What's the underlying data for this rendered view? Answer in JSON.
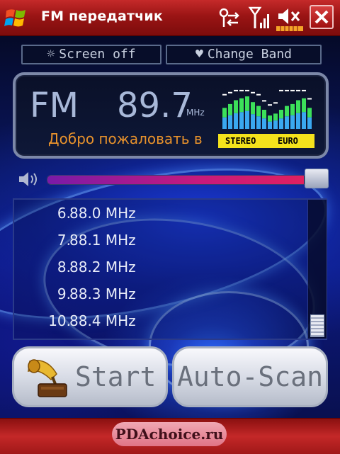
{
  "titlebar": {
    "title": "FM передатчик"
  },
  "toolbar": {
    "screen_off_label": "Screen off",
    "change_band_label": "Change Band"
  },
  "display": {
    "band": "FM",
    "frequency": "89.7",
    "frequency_unit": "MHz",
    "rds_text": "Добро пожаловать в",
    "stereo_label": "STEREO",
    "region_label": "EURO",
    "equalizer_levels": [
      0.55,
      0.65,
      0.75,
      0.8,
      0.85,
      0.7,
      0.6,
      0.5,
      0.35,
      0.4,
      0.5,
      0.6,
      0.65,
      0.75,
      0.8,
      0.55
    ],
    "equalizer_peaks": [
      0.85,
      0.9,
      0.95,
      0.95,
      0.95,
      0.9,
      0.85,
      0.7,
      0.6,
      0.65,
      0.95,
      0.95,
      0.95,
      0.95,
      0.95,
      0.75
    ]
  },
  "volume": {
    "level": 0.99
  },
  "presets": {
    "items": [
      {
        "number": "6.",
        "frequency": "88.0 MHz"
      },
      {
        "number": "7.",
        "frequency": "88.1 MHz"
      },
      {
        "number": "8.",
        "frequency": "88.2 MHz"
      },
      {
        "number": "9.",
        "frequency": "88.3 MHz"
      },
      {
        "number": "10.",
        "frequency": "88.4 MHz"
      }
    ],
    "scroll_position": 1.0
  },
  "buttons": {
    "start_label": "Start",
    "autoscan_label": "Auto-Scan"
  },
  "watermark": "PDAchoice.ru",
  "colors": {
    "titlebar": "#a01818",
    "display_text": "#a8b8d8",
    "rds_text": "#e8922c",
    "badge": "#f4e21c",
    "volume_fill": "#e02060"
  },
  "icons": {
    "start_menu": "windows-flag-icon",
    "connectivity": "connectivity-icon",
    "signal": "signal-icon",
    "speaker": "speaker-muted-icon",
    "close": "close-icon",
    "screen_off": "sun-icon",
    "change_band": "antenna-icon",
    "volume": "volume-icon",
    "start_button": "gramophone-icon"
  }
}
